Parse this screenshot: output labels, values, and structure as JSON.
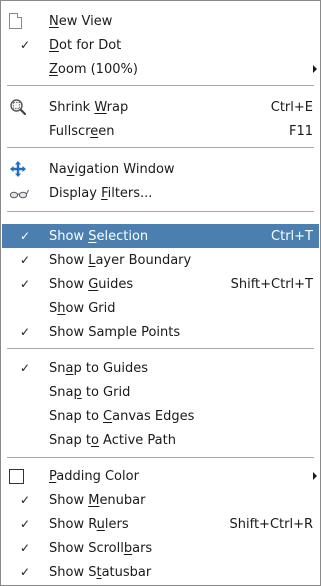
{
  "items": [
    {
      "name": "new-view",
      "pre": "",
      "u": "N",
      "post": "ew View",
      "acc": "",
      "check": false,
      "icon": "page-icon"
    },
    {
      "name": "dot-for-dot",
      "pre": "",
      "u": "D",
      "post": "ot for Dot",
      "acc": "",
      "check": true
    },
    {
      "name": "zoom",
      "pre": "",
      "u": "Z",
      "post": "oom (100%)",
      "acc": "",
      "submenu": true
    },
    {
      "name": "shrink-wrap",
      "pre": "Shrink ",
      "u": "W",
      "post": "rap",
      "acc": "Ctrl+E",
      "icon": "magnifier-icon"
    },
    {
      "name": "fullscreen",
      "pre": "Fullscr",
      "u": "e",
      "post": "en",
      "acc": "F11"
    },
    {
      "name": "navigation-window",
      "pre": "Na",
      "u": "v",
      "post": "igation Window",
      "acc": "",
      "icon": "move-cross-icon"
    },
    {
      "name": "display-filters",
      "pre": "Display ",
      "u": "F",
      "post": "ilters...",
      "acc": "",
      "icon": "glasses-icon"
    },
    {
      "name": "show-selection",
      "pre": "Show ",
      "u": "S",
      "post": "election",
      "acc": "Ctrl+T",
      "check": true,
      "highlight": true
    },
    {
      "name": "show-layer-boundary",
      "pre": "Show ",
      "u": "L",
      "post": "ayer Boundary",
      "acc": "",
      "check": true
    },
    {
      "name": "show-guides",
      "pre": "Show ",
      "u": "G",
      "post": "uides",
      "acc": "Shift+Ctrl+T",
      "check": true
    },
    {
      "name": "show-grid",
      "pre": "S",
      "u": "h",
      "post": "ow Grid",
      "acc": "",
      "check": false
    },
    {
      "name": "show-sample-points",
      "pre": "Show Sample Points",
      "u": "",
      "post": "",
      "acc": "",
      "check": true
    },
    {
      "name": "snap-to-guides",
      "pre": "Sn",
      "u": "a",
      "post": "p to Guides",
      "acc": "",
      "check": true
    },
    {
      "name": "snap-to-grid",
      "pre": "Sna",
      "u": "p",
      "post": " to Grid",
      "acc": "",
      "check": false
    },
    {
      "name": "snap-to-canvas-edges",
      "pre": "Snap to ",
      "u": "C",
      "post": "anvas Edges",
      "acc": "",
      "check": false
    },
    {
      "name": "snap-to-active-path",
      "pre": "Snap t",
      "u": "o",
      "post": " Active Path",
      "acc": "",
      "check": false
    },
    {
      "name": "padding-color",
      "pre": "",
      "u": "P",
      "post": "adding Color",
      "acc": "",
      "icon": "color-swatch-icon",
      "submenu": true
    },
    {
      "name": "show-menubar",
      "pre": "Show ",
      "u": "M",
      "post": "enubar",
      "acc": "",
      "check": true
    },
    {
      "name": "show-rulers",
      "pre": "Show R",
      "u": "u",
      "post": "lers",
      "acc": "Shift+Ctrl+R",
      "check": true
    },
    {
      "name": "show-scrollbars",
      "pre": "Show Scroll",
      "u": "b",
      "post": "ars",
      "acc": "",
      "check": true
    },
    {
      "name": "show-statusbar",
      "pre": "Show S",
      "u": "t",
      "post": "atusbar",
      "acc": "",
      "check": true
    }
  ],
  "check_glyph": "✓",
  "colors": {
    "highlight": "#4a7fb0",
    "highlight_text": "#ffffff",
    "text": "#1a1a1a",
    "separator": "#a8a8a8",
    "nav_icon": "#1e6fc0"
  }
}
